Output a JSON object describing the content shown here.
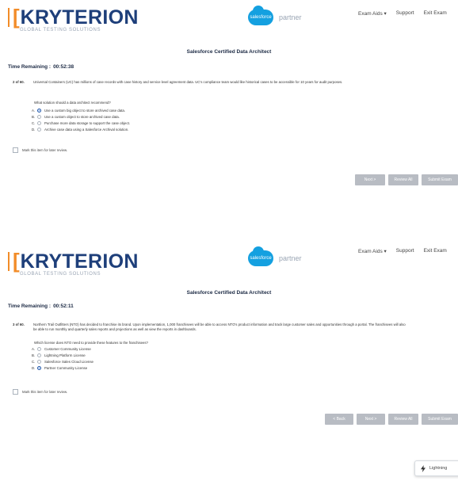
{
  "brand": {
    "logo_bracket": "[",
    "logo_text": "KRYTERION",
    "logo_sub": "GLOBAL TESTING SOLUTIONS",
    "sf_cloud": "salesforce",
    "sf_partner": "partner"
  },
  "screens": [
    {
      "toplinks": [
        "Exam Aids ▾",
        "Support",
        "Exit Exam"
      ],
      "exam_title": "Salesforce Certified Data Architect",
      "time_label": "Time Remaining :",
      "time_value": "00:52:38",
      "question_number": "2 of 60.",
      "question_text": "Universal Containers (UC) has millions of case records with case history and service level agreement data. UC's compliance team would like historical cases to be accessible for 10 years for audit purposes.",
      "prompt": "What solution should a data architect recommend?",
      "options": [
        {
          "letter": "A.",
          "text": "Use a custom big object to store archived case data.",
          "selected": true
        },
        {
          "letter": "B.",
          "text": "Use a custom object to store archived case data.",
          "selected": false
        },
        {
          "letter": "C.",
          "text": "Purchase more data storage to support the case object.",
          "selected": false
        },
        {
          "letter": "D.",
          "text": "Archive case data using a Salesforce Archival solution.",
          "selected": false
        }
      ],
      "mark_label": "Mark this item for later review.",
      "buttons": [
        "Next >",
        "Review All",
        "Submit Exam"
      ]
    },
    {
      "toplinks": [
        "Exam Aids ▾",
        "Support",
        "Exit Exam"
      ],
      "exam_title": "Salesforce Certified Data Architect",
      "time_label": "Time Remaining :",
      "time_value": "00:52:11",
      "question_number": "3 of 60.",
      "question_text": "Northern Trail Outfitters (NTO) has decided to franchise its brand. Upon implementation, 1,000 franchisees will be able to access NTO's product information and track large customer sales and opportunities through a portal. The franchisees will also be able to run monthly and quarterly sales reports and projections as well as view the reports in dashboards.",
      "prompt": "Which license does NTO need to provide these features to the franchisees?",
      "options": [
        {
          "letter": "A.",
          "text": "Customer Community License",
          "selected": false
        },
        {
          "letter": "B.",
          "text": "Lightning Platform License",
          "selected": false
        },
        {
          "letter": "C.",
          "text": "Salesforce Sales Cloud License",
          "selected": false
        },
        {
          "letter": "D.",
          "text": "Partner Community License",
          "selected": true
        }
      ],
      "mark_label": "Mark this item for later review.",
      "buttons": [
        "< Back",
        "Next >",
        "Review All",
        "Submit Exam"
      ]
    }
  ],
  "lightning": {
    "label": "Lightning"
  }
}
